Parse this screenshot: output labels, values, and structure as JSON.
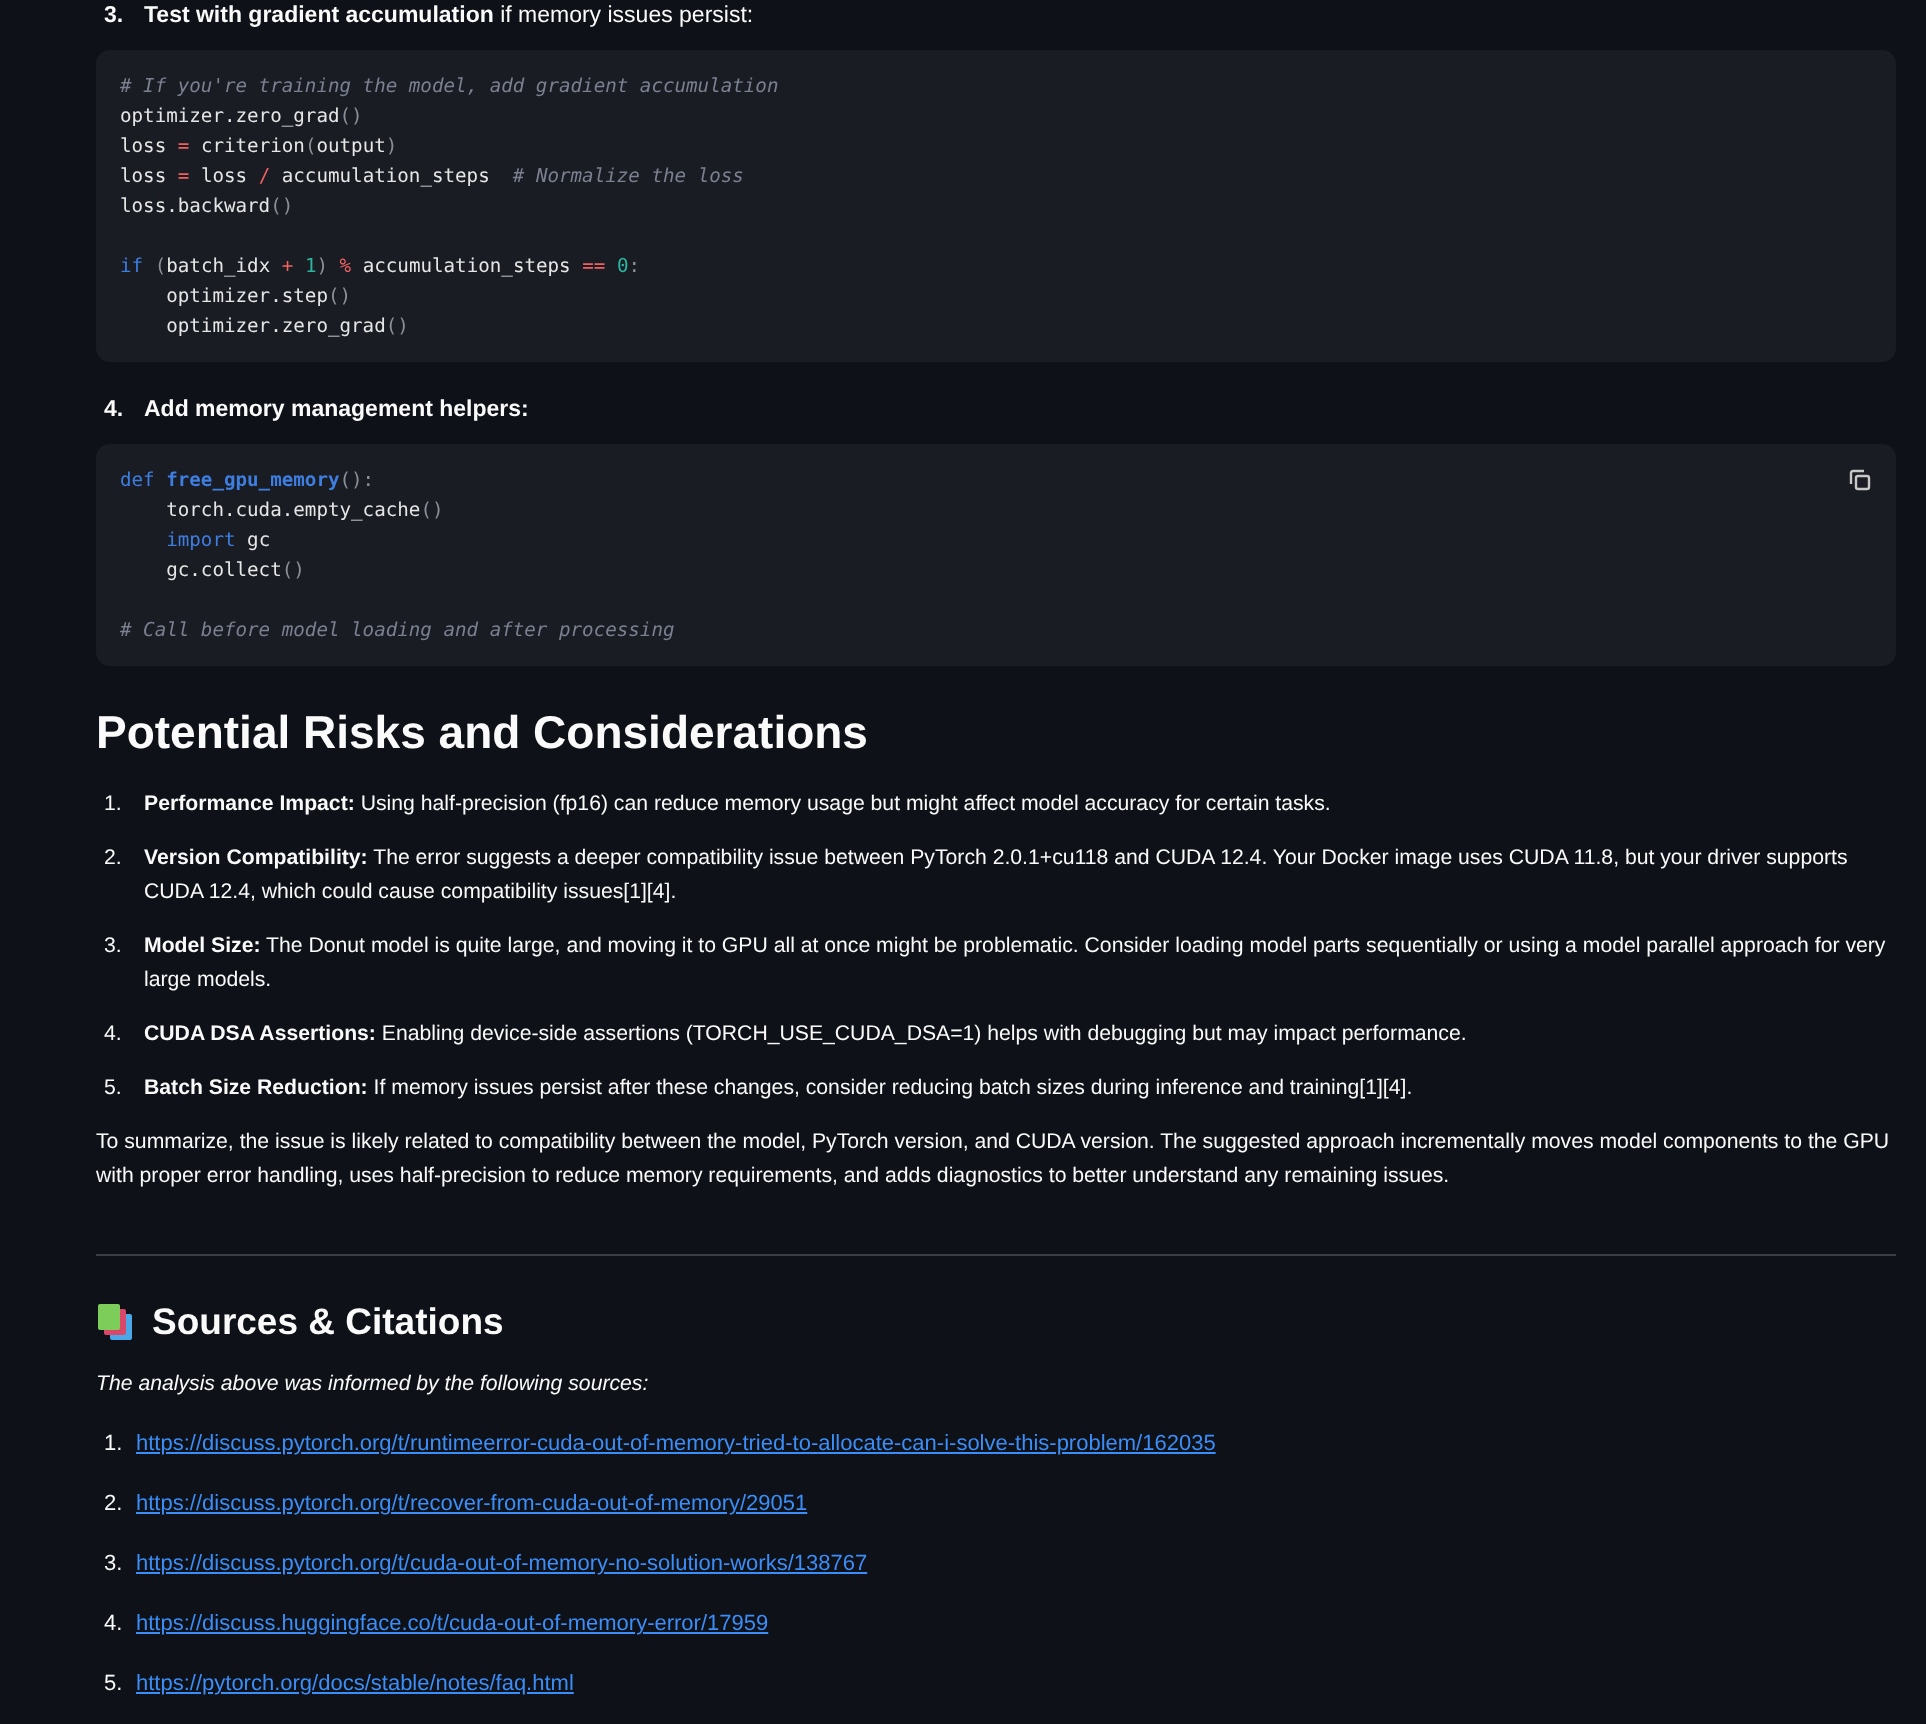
{
  "steps": [
    {
      "number": "3.",
      "label": "**Test with gradient accumulation** if memory issues persist:",
      "bold": false,
      "copy_button": false,
      "code": [
        {
          "kind": "code",
          "tokens": [
            {
              "text": "# If you're training the model, add gradient accumulation",
              "kind": "comment"
            }
          ]
        },
        {
          "kind": "code",
          "tokens": [
            {
              "text": "optimizer.zero_grad",
              "kind": "plain"
            },
            {
              "text": "()",
              "kind": "punct"
            }
          ]
        },
        {
          "kind": "code",
          "tokens": [
            {
              "text": "loss ",
              "kind": "plain"
            },
            {
              "text": "=",
              "kind": "op"
            },
            {
              "text": " criterion",
              "kind": "plain"
            },
            {
              "text": "(",
              "kind": "punct"
            },
            {
              "text": "output",
              "kind": "plain"
            },
            {
              "text": ")",
              "kind": "punct"
            }
          ]
        },
        {
          "kind": "code",
          "tokens": [
            {
              "text": "loss ",
              "kind": "plain"
            },
            {
              "text": "=",
              "kind": "op"
            },
            {
              "text": " loss ",
              "kind": "plain"
            },
            {
              "text": "/",
              "kind": "op"
            },
            {
              "text": " accumulation_steps  ",
              "kind": "plain"
            },
            {
              "text": "# Normalize the loss",
              "kind": "comment"
            }
          ]
        },
        {
          "kind": "code",
          "tokens": [
            {
              "text": "loss.backward",
              "kind": "plain"
            },
            {
              "text": "()",
              "kind": "punct"
            }
          ]
        },
        {
          "kind": "blank"
        },
        {
          "kind": "code",
          "tokens": [
            {
              "text": "if",
              "kind": "keyword"
            },
            {
              "text": " (",
              "kind": "punct"
            },
            {
              "text": "batch_idx ",
              "kind": "plain"
            },
            {
              "text": "+",
              "kind": "op"
            },
            {
              "text": " 1",
              "kind": "number"
            },
            {
              "text": ") ",
              "kind": "punct"
            },
            {
              "text": "%",
              "kind": "op"
            },
            {
              "text": " accumulation_steps ",
              "kind": "plain"
            },
            {
              "text": "==",
              "kind": "op"
            },
            {
              "text": " 0",
              "kind": "number"
            },
            {
              "text": ":",
              "kind": "punct"
            }
          ]
        },
        {
          "kind": "code",
          "tokens": [
            {
              "text": "    optimizer.step",
              "kind": "plain"
            },
            {
              "text": "()",
              "kind": "punct"
            }
          ]
        },
        {
          "kind": "code",
          "tokens": [
            {
              "text": "    optimizer.zero_grad",
              "kind": "plain"
            },
            {
              "text": "()",
              "kind": "punct"
            }
          ]
        }
      ]
    },
    {
      "number": "4.",
      "label": "Add memory management helpers:",
      "bold": true,
      "copy_button": true,
      "code": [
        {
          "kind": "code",
          "tokens": [
            {
              "text": "def",
              "kind": "keyword"
            },
            {
              "text": " free_gpu_memory",
              "kind": "function"
            },
            {
              "text": "():",
              "kind": "punct"
            }
          ]
        },
        {
          "kind": "code",
          "tokens": [
            {
              "text": "    torch.cuda.empty_cache",
              "kind": "plain"
            },
            {
              "text": "()",
              "kind": "punct"
            }
          ]
        },
        {
          "kind": "code",
          "tokens": [
            {
              "text": "    import",
              "kind": "keyword"
            },
            {
              "text": " gc",
              "kind": "plain"
            }
          ]
        },
        {
          "kind": "code",
          "tokens": [
            {
              "text": "    gc.collect",
              "kind": "plain"
            },
            {
              "text": "()",
              "kind": "punct"
            }
          ]
        },
        {
          "kind": "blank"
        },
        {
          "kind": "code",
          "tokens": [
            {
              "text": "# Call before model loading and after processing",
              "kind": "comment"
            }
          ]
        }
      ]
    }
  ],
  "risks": {
    "heading": "Potential Risks and Considerations",
    "items": [
      {
        "number": "1.",
        "text": "**Performance Impact:** Using half-precision (fp16) can reduce memory usage but might affect model accuracy for certain tasks."
      },
      {
        "number": "2.",
        "text": "**Version Compatibility:** The error suggests a deeper compatibility issue between PyTorch 2.0.1+cu118 and CUDA 12.4. Your Docker image uses CUDA 11.8, but your driver supports CUDA 12.4, which could cause compatibility issues[1][4]."
      },
      {
        "number": "3.",
        "text": "**Model Size:** The Donut model is quite large, and moving it to GPU all at once might be problematic. Consider loading model parts sequentially or using a model parallel approach for very large models."
      },
      {
        "number": "4.",
        "text": "**CUDA DSA Assertions:** Enabling device-side assertions (TORCH_USE_CUDA_DSA=1) helps with debugging but may impact performance."
      },
      {
        "number": "5.",
        "text": "**Batch Size Reduction:** If memory issues persist after these changes, consider reducing batch sizes during inference and training[1][4]."
      }
    ],
    "summary": "To summarize, the issue is likely related to compatibility between the model, PyTorch version, and CUDA version. The suggested approach incrementally moves model components to the GPU with proper error handling, uses half-precision to reduce memory requirements, and adds diagnostics to better understand any remaining issues."
  },
  "sources": {
    "heading": "Sources & Citations",
    "intro": "The analysis above was informed by the following sources:",
    "links": [
      {
        "number": "1.",
        "url": "https://discuss.pytorch.org/t/runtimeerror-cuda-out-of-memory-tried-to-allocate-can-i-solve-this-problem/162035"
      },
      {
        "number": "2.",
        "url": "https://discuss.pytorch.org/t/recover-from-cuda-out-of-memory/29051"
      },
      {
        "number": "3.",
        "url": "https://discuss.pytorch.org/t/cuda-out-of-memory-no-solution-works/138767"
      },
      {
        "number": "4.",
        "url": "https://discuss.huggingface.co/t/cuda-out-of-memory-error/17959"
      },
      {
        "number": "5.",
        "url": "https://pytorch.org/docs/stable/notes/faq.html"
      }
    ]
  }
}
